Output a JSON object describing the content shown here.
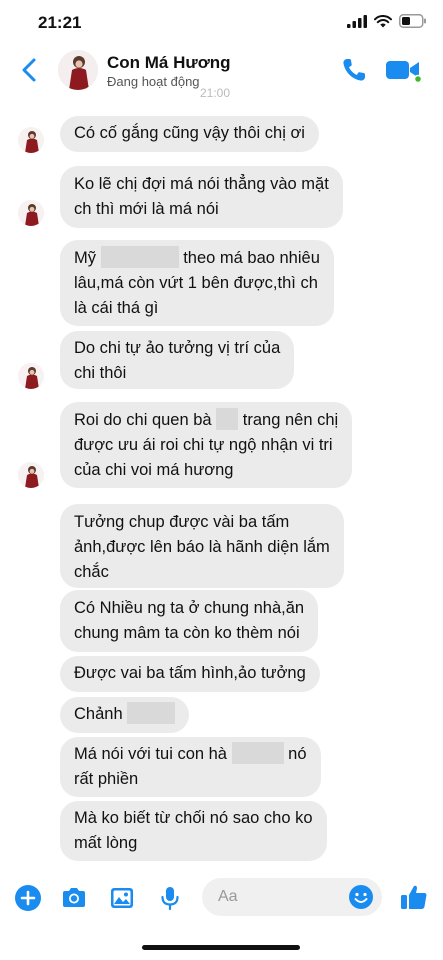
{
  "status_bar": {
    "time": "21:21"
  },
  "header": {
    "contact_name": "Con Má Hương",
    "contact_status": "Đang hoạt động",
    "ghost_time": "21:00"
  },
  "messages": [
    {
      "lines": [
        "Có cố gắng cũng vậy thôi chị ơi"
      ]
    },
    {
      "lines": [
        "Ko lẽ chị đợi má nói thẳng vào mặt",
        "ch thì mới là má nói"
      ]
    },
    {
      "lines": [
        "Mỹ",
        "theo má bao nhiêu",
        "lâu,má còn vứt 1 bên được,thì ch",
        "là cái thá gì"
      ]
    },
    {
      "lines": [
        "Do chi tự ảo tưởng vị trí của",
        "chi thôi"
      ]
    },
    {
      "lines": [
        "Roi do chi quen bà",
        "trang nên chị",
        "được ưu ái roi chi tự ngộ nhận vi tri",
        "của chi voi má hương"
      ]
    },
    {
      "lines": [
        "Tưởng chup được vài ba tấm",
        "ảnh,được lên báo là hãnh diện lắm",
        "chắc"
      ]
    },
    {
      "lines": [
        "Có Nhiều ng ta ở chung nhà,ăn",
        "chung mâm ta còn ko thèm nói"
      ]
    },
    {
      "lines": [
        "Được vai ba tấm hình,ảo tưởng"
      ]
    },
    {
      "lines": [
        "Chảnh"
      ]
    },
    {
      "lines": [
        "Má nói với tui con hà",
        "nó",
        "rất phiền"
      ]
    },
    {
      "lines": [
        "Mà ko biết từ chối nó sao cho ko",
        "mất lòng"
      ]
    }
  ],
  "composer": {
    "placeholder": "Aa"
  },
  "colors": {
    "accent": "#1a8cf0",
    "bubble": "#ebebeb",
    "redaction": "#d9d9d9"
  }
}
